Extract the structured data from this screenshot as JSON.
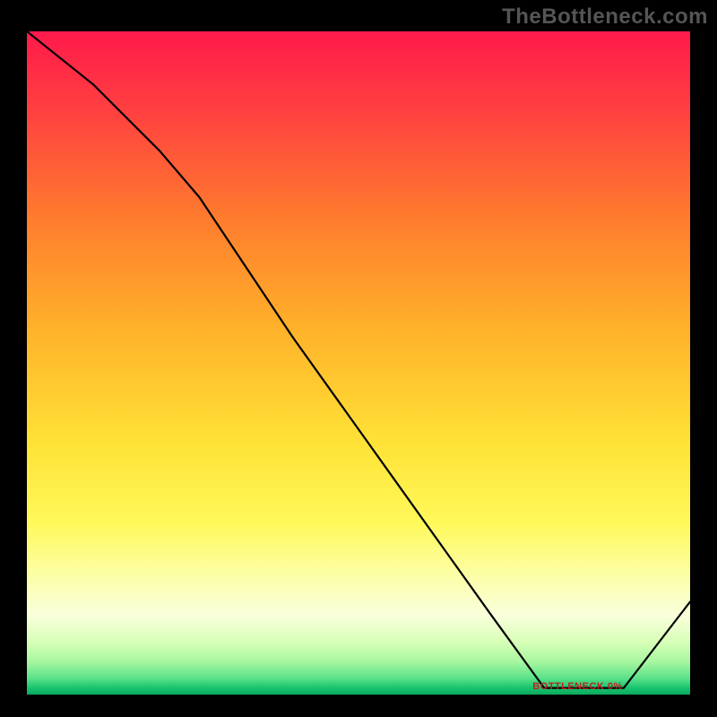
{
  "watermark": "TheBottleneck.com",
  "chart_data": {
    "type": "line",
    "title": "",
    "xlabel": "",
    "ylabel": "",
    "x_range": [
      0,
      100
    ],
    "y_range": [
      0,
      100
    ],
    "grid": false,
    "legend": false,
    "background": "gradient-red-yellow-green",
    "series": [
      {
        "name": "bottleneck-curve",
        "x": [
          0,
          10,
          20,
          26,
          40,
          55,
          70,
          78,
          90,
          100
        ],
        "y": [
          100,
          92,
          82,
          75,
          54,
          33,
          12,
          1,
          1,
          14
        ]
      }
    ],
    "annotations": [
      {
        "id": "bottom-label",
        "text": "BOTTLENECK 0%",
        "x": 83,
        "y": 1
      }
    ]
  },
  "colors": {
    "frame": "#000000",
    "line": "#000000",
    "watermark": "#555555",
    "annotation": "#c02020"
  }
}
